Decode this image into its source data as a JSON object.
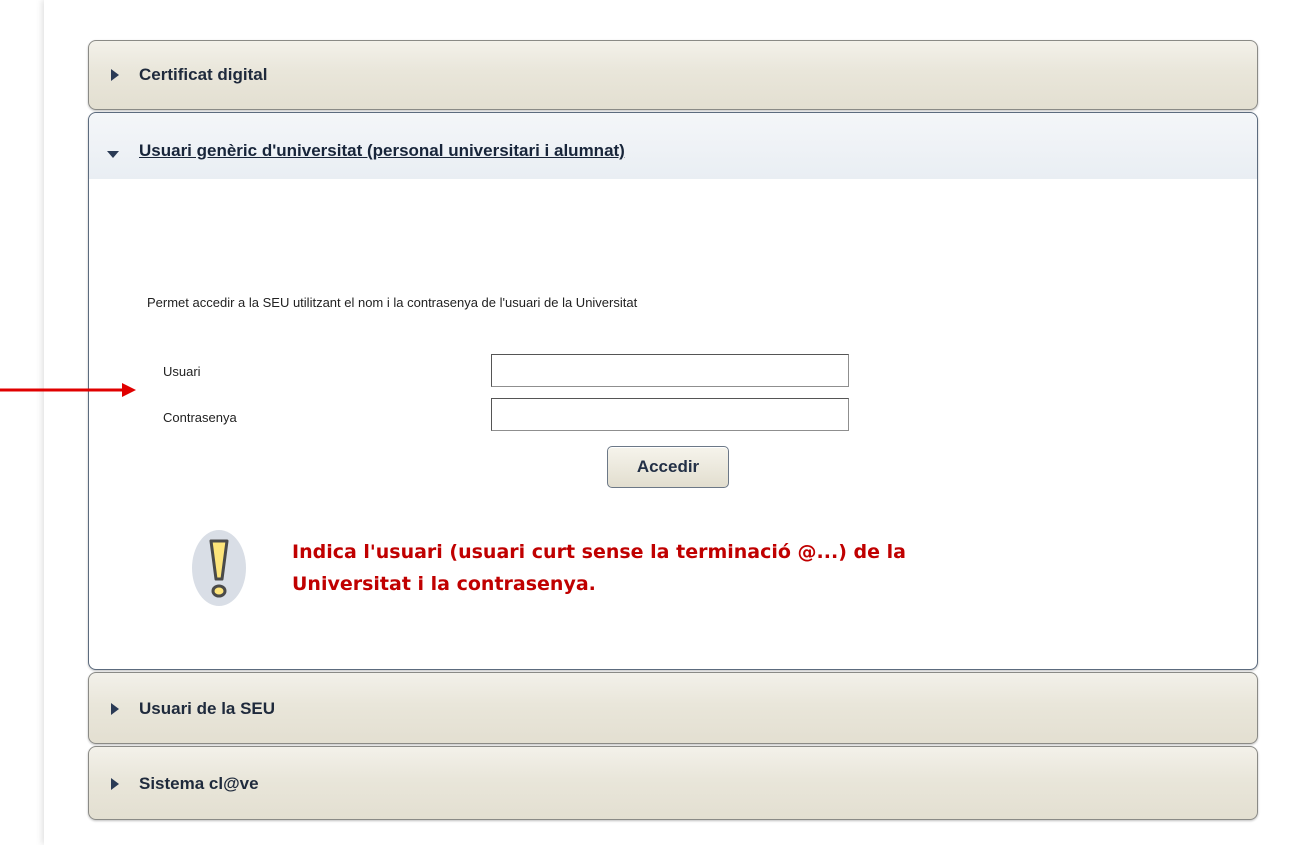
{
  "accordion": {
    "sections": [
      {
        "label": "Certificat digital"
      },
      {
        "label": "Usuari genèric d'universitat (personal universitari i alumnat)"
      },
      {
        "label": "Usuari de la SEU"
      },
      {
        "label": "Sistema cl@ve"
      }
    ]
  },
  "login": {
    "description": "Permet accedir a la SEU utilitzant el nom i la contrasenya de l'usuari de la Universitat",
    "user_label": "Usuari",
    "user_value": "",
    "password_label": "Contrasenya",
    "password_value": "",
    "submit_label": "Accedir"
  },
  "annotation": {
    "note_line1": "Indica l'usuari (usuari curt sense la terminació @...) de la",
    "note_line2": "Universitat i la contrasenya.",
    "note_color": "#c00000",
    "arrow_color": "#e00000",
    "icon": "exclamation-icon"
  }
}
